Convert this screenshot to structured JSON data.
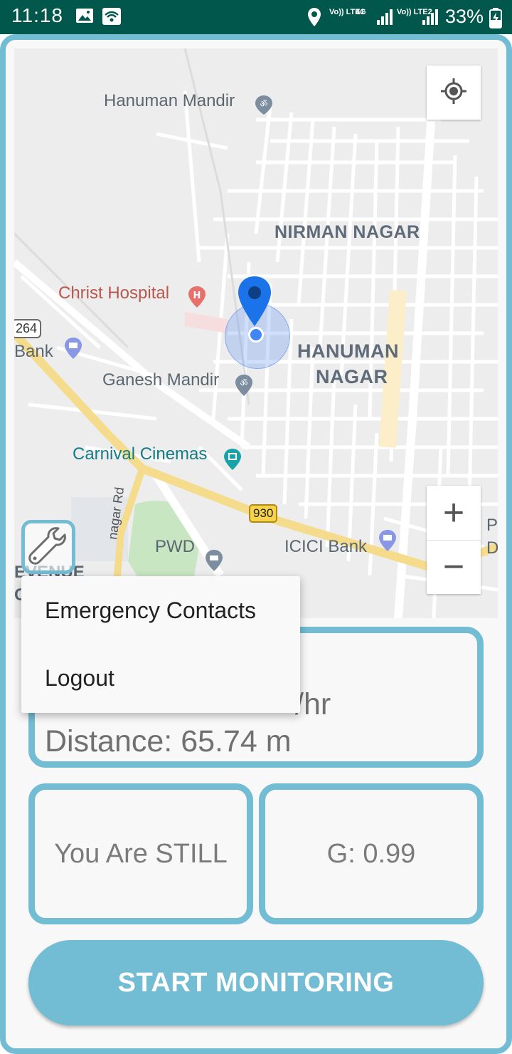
{
  "status_bar": {
    "time": "11:18",
    "net1": "Vo)) LTE1",
    "net_4g": "4G",
    "net2": "Vo)) LTE2",
    "battery": "33%",
    "icons": [
      "image-icon",
      "wifi-icon",
      "location-icon",
      "signal-icon",
      "battery-charging-icon"
    ]
  },
  "map": {
    "labels": {
      "hanuman_mandir": "Hanuman Mandir",
      "nirman_nagar": "NIRMAN NAGAR",
      "christ_hospital": "Christ Hospital",
      "road_264": "264",
      "bank": "Bank",
      "hanuman_nagar_1": "HANUMAN",
      "hanuman_nagar_2": "NAGAR",
      "ganesh_mandir": "Ganesh Mandir",
      "carnival_cinemas": "Carnival Cinemas",
      "road_930": "930",
      "pwd": "PWD",
      "icici_bank": "ICICI Bank",
      "nagar_rd": "nagar Rd",
      "avenue": "EVENUE",
      "co": "CO",
      "edge_p": "P",
      "edge_d": "D"
    },
    "icons": [
      "temple-icon",
      "hospital-icon",
      "bank-icon",
      "cinema-icon",
      "museum-icon",
      "location-pin-icon",
      "my-location-icon"
    ]
  },
  "controls": {
    "zoom_in": "+",
    "zoom_out": "−"
  },
  "info": {
    "speed_partial": "/hr",
    "distance": "Distance: 65.74 m"
  },
  "motion_status": "You Are STILL",
  "g_force": "G: 0.99",
  "start_button": "START MONITORING",
  "menu": {
    "items": [
      "Emergency Contacts",
      "Logout"
    ]
  },
  "colors": {
    "accent": "#72bcd4",
    "status_bar": "#01574c",
    "pin": "#1a73e8"
  }
}
